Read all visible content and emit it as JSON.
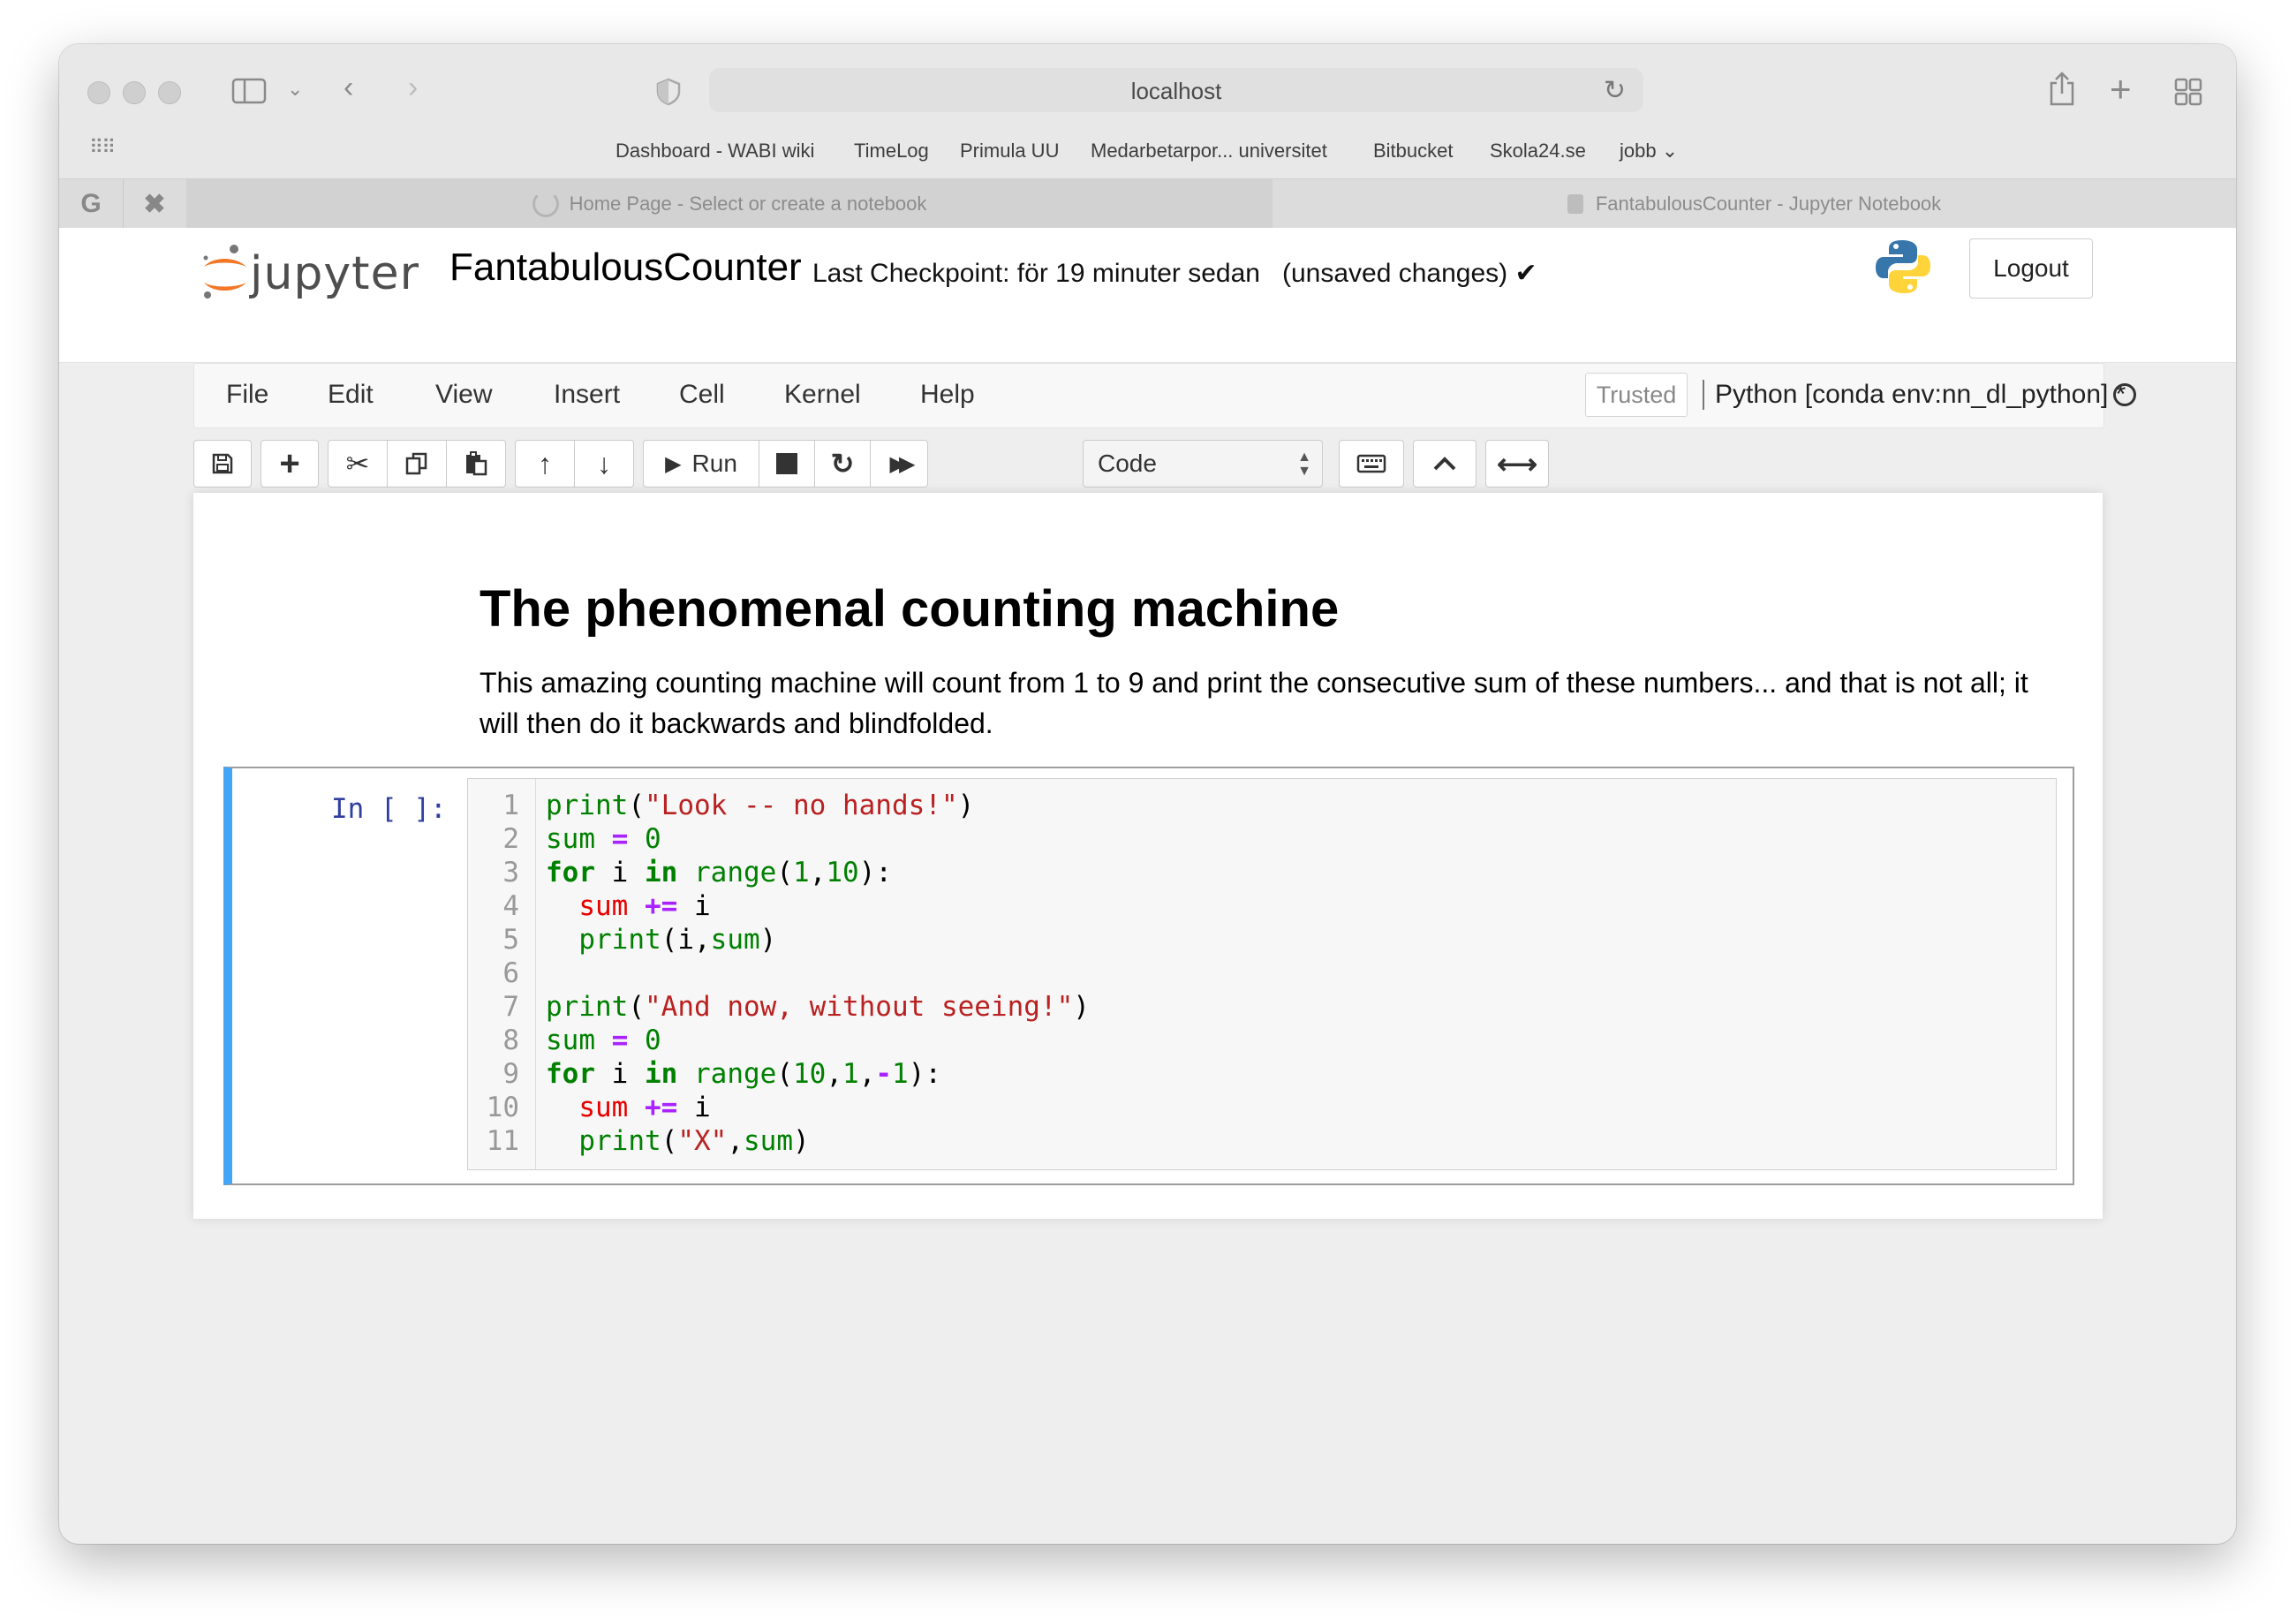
{
  "browser": {
    "url": "localhost",
    "bookmarks": [
      "Dashboard - WABI wiki",
      "TimeLog",
      "Primula UU",
      "Medarbetarpor... universitet",
      "Bitbucket",
      "Skola24.se",
      "jobb"
    ],
    "tabs": [
      {
        "title": "Home Page - Select or create a notebook",
        "state": "loading"
      },
      {
        "title": "FantabulousCounter - Jupyter Notebook",
        "state": "active"
      }
    ]
  },
  "header": {
    "logo_text": "jupyter",
    "notebook_name": "FantabulousCounter",
    "checkpoint": "Last Checkpoint: för 19 minuter sedan",
    "unsaved": "(unsaved changes)",
    "logout_label": "Logout"
  },
  "menubar": {
    "items": [
      "File",
      "Edit",
      "View",
      "Insert",
      "Cell",
      "Kernel",
      "Help"
    ],
    "trusted_label": "Trusted",
    "kernel_label": "Python [conda env:nn_dl_python] *"
  },
  "toolbar": {
    "run_label": "Run",
    "cell_type": "Code",
    "icons": [
      "save-icon",
      "plus-icon",
      "scissors-icon",
      "copy-icon",
      "paste-icon",
      "arrow-up-icon",
      "arrow-down-icon",
      "play-icon",
      "stop-icon",
      "restart-icon",
      "fast-forward-icon",
      "keyboard-icon",
      "chevron-up-icon",
      "arrows-horizontal-icon"
    ]
  },
  "markdown_cell": {
    "title": "The phenomenal counting machine",
    "paragraph": "This amazing counting machine will count from 1 to 9 and print the consecutive sum of these numbers... and that is not all; it will then do it backwards and blindfolded."
  },
  "code_cell": {
    "prompt": "In [ ]:",
    "line_numbers": [
      "1",
      "2",
      "3",
      "4",
      "5",
      "6",
      "7",
      "8",
      "9",
      "10",
      "11"
    ],
    "lines": [
      "print(\"Look -- no hands!\")",
      "sum = 0",
      "for i in range(1,10):",
      "  sum += i",
      "  print(i,sum)",
      "",
      "print(\"And now, without seeing!\")",
      "sum = 0",
      "for i in range(10,1,-1):",
      "  sum += i",
      "  print(\"X\",sum)"
    ]
  },
  "colors": {
    "cell_selected_accent": "#42a5f5",
    "prompt_in": "#303f9f",
    "keyword": "#008000",
    "string": "#ba2121",
    "operator": "#aa22ff"
  }
}
